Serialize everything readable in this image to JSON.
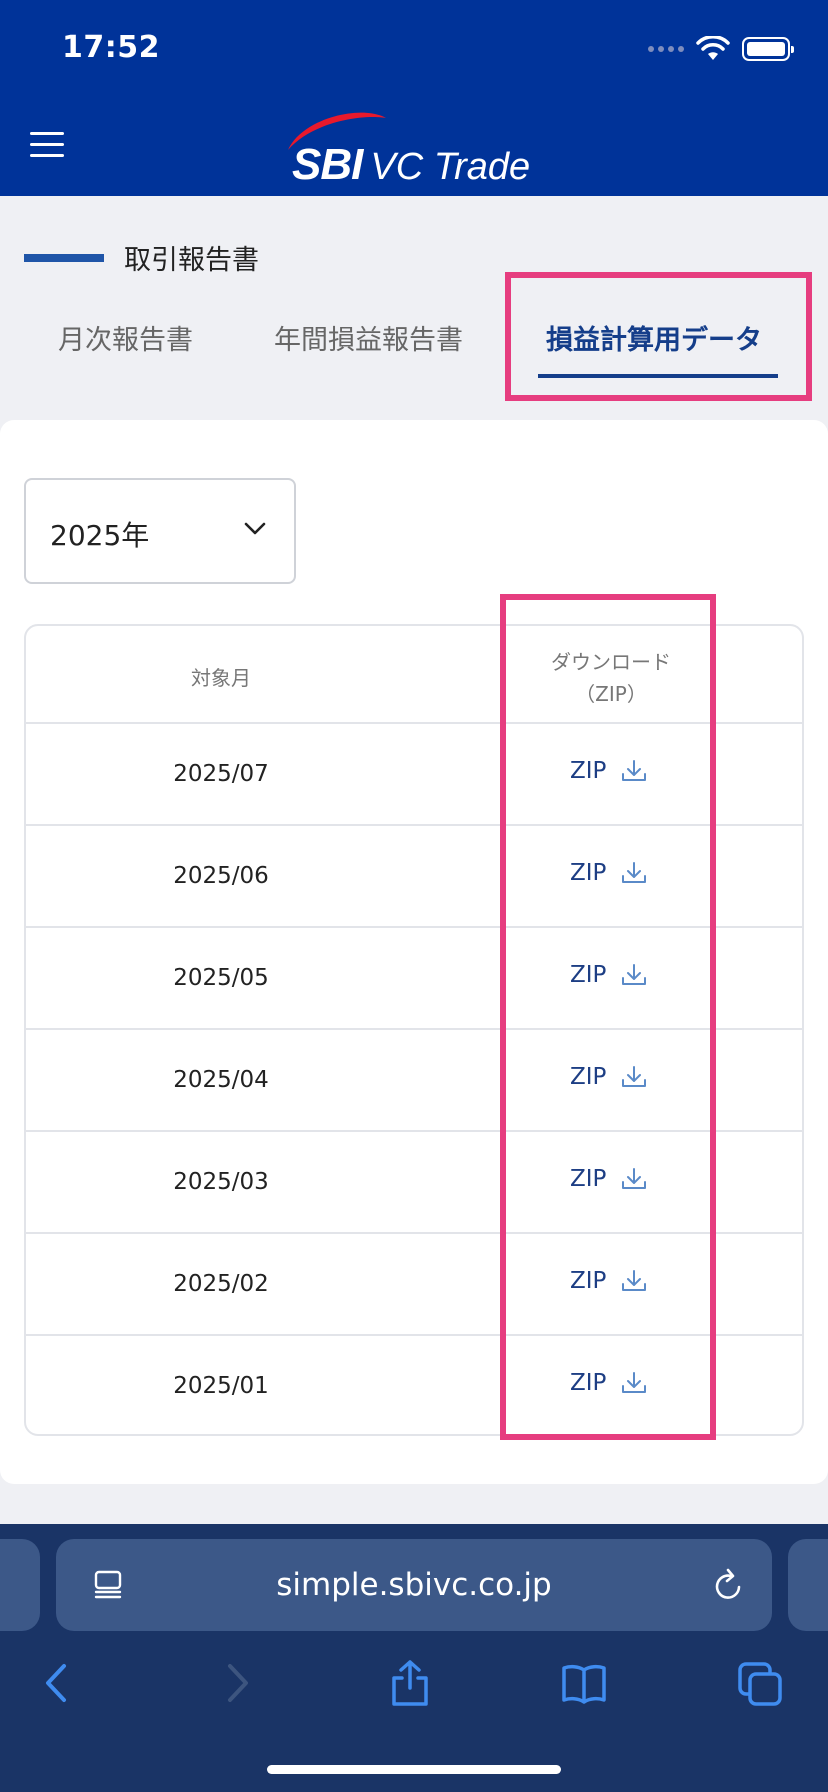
{
  "status_bar": {
    "time": "17:52"
  },
  "header": {
    "logo_sbi": "SBI",
    "logo_vc": "VC Trade"
  },
  "section": {
    "title": "取引報告書"
  },
  "tabs": [
    {
      "label": "月次報告書",
      "active": false
    },
    {
      "label": "年間損益報告書",
      "active": false
    },
    {
      "label": "損益計算用データ",
      "active": true
    }
  ],
  "year_select": {
    "value": "2025年"
  },
  "table": {
    "headers": {
      "month": "対象月",
      "download_line1": "ダウンロード",
      "download_line2": "（ZIP）"
    },
    "rows": [
      {
        "month": "2025/07",
        "link": "ZIP"
      },
      {
        "month": "2025/06",
        "link": "ZIP"
      },
      {
        "month": "2025/05",
        "link": "ZIP"
      },
      {
        "month": "2025/04",
        "link": "ZIP"
      },
      {
        "month": "2025/03",
        "link": "ZIP"
      },
      {
        "month": "2025/02",
        "link": "ZIP"
      },
      {
        "month": "2025/01",
        "link": "ZIP"
      }
    ]
  },
  "browser": {
    "url": "simple.sbivc.co.jp"
  },
  "colors": {
    "brand": "#003399",
    "highlight": "#e63d7f",
    "link": "#1d3e84",
    "ios_blue": "#3f8cf0"
  }
}
